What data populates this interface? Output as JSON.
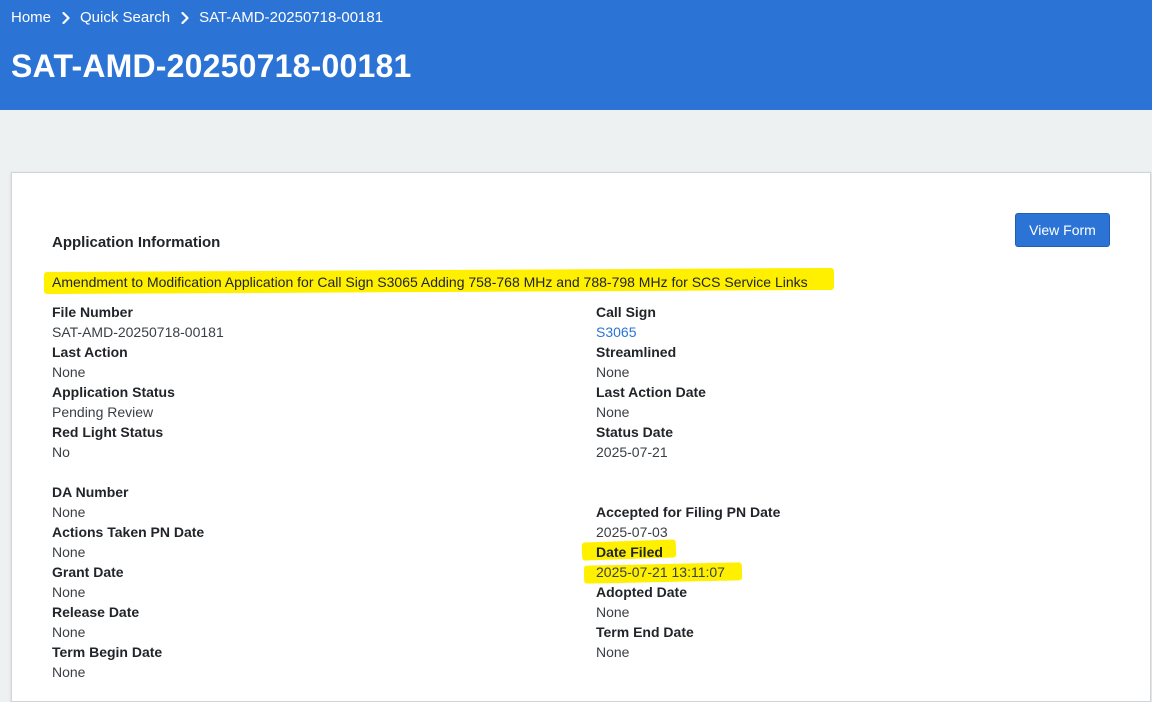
{
  "breadcrumb": {
    "home": "Home",
    "quick_search": "Quick Search",
    "current": "SAT-AMD-20250718-00181"
  },
  "page_title": "SAT-AMD-20250718-00181",
  "card": {
    "view_form_label": "View Form",
    "section_title": "Application Information",
    "description": "Amendment to Modification Application for Call Sign S3065 Adding 758-768 MHz and 788-798 MHz for SCS Service Links"
  },
  "fields": {
    "file_number": {
      "label": "File Number",
      "value": "SAT-AMD-20250718-00181"
    },
    "last_action": {
      "label": "Last Action",
      "value": "None"
    },
    "application_status": {
      "label": "Application Status",
      "value": "Pending Review"
    },
    "red_light_status": {
      "label": "Red Light Status",
      "value": "No"
    },
    "da_number": {
      "label": "DA Number",
      "value": "None"
    },
    "actions_taken_pn_date": {
      "label": "Actions Taken PN Date",
      "value": "None"
    },
    "grant_date": {
      "label": "Grant Date",
      "value": "None"
    },
    "release_date": {
      "label": "Release Date",
      "value": "None"
    },
    "term_begin_date": {
      "label": "Term Begin Date",
      "value": "None"
    },
    "call_sign": {
      "label": "Call Sign",
      "value": "S3065"
    },
    "streamlined": {
      "label": "Streamlined",
      "value": "None"
    },
    "last_action_date": {
      "label": "Last Action Date",
      "value": "None"
    },
    "status_date": {
      "label": "Status Date",
      "value": "2025-07-21"
    },
    "accepted_for_filing_pn_date": {
      "label": "Accepted for Filing PN Date",
      "value": "2025-07-03"
    },
    "date_filed": {
      "label": "Date Filed",
      "value": "2025-07-21 13:11:07"
    },
    "adopted_date": {
      "label": "Adopted Date",
      "value": "None"
    },
    "term_end_date": {
      "label": "Term End Date",
      "value": "None"
    }
  },
  "colors": {
    "header_bg": "#2b74d6",
    "page_bg": "#eef1f2",
    "highlight": "#fff000",
    "link": "#2b74d6"
  }
}
